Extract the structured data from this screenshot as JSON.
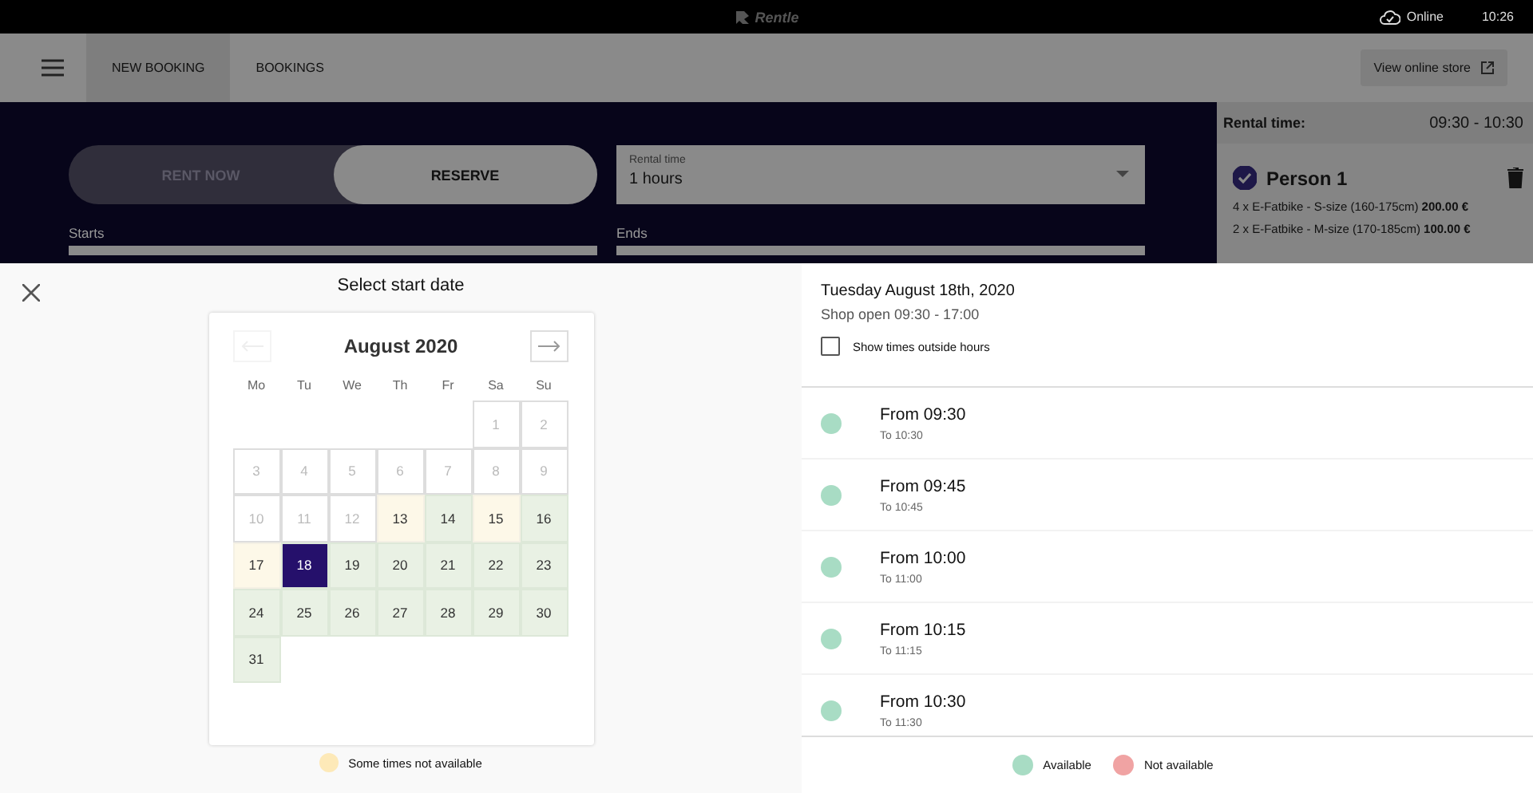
{
  "top_bar": {
    "logo": "Rentle",
    "connection": "Online",
    "time": "10:26"
  },
  "nav": {
    "tabs": [
      {
        "label": "NEW BOOKING",
        "selected": true
      },
      {
        "label": "BOOKINGS",
        "selected": false
      }
    ],
    "store_button": "View online store"
  },
  "booking_form": {
    "modes": [
      {
        "label": "RENT NOW",
        "selected": false
      },
      {
        "label": "RESERVE",
        "selected": true
      }
    ],
    "rental_time": {
      "label": "Rental time",
      "value": "1 hours"
    },
    "starts_label": "Starts",
    "ends_label": "Ends"
  },
  "summary": {
    "rental_time_label": "Rental time:",
    "rental_time_value": "09:30 - 10:30",
    "person": {
      "name": "Person 1",
      "checked": true,
      "items": [
        {
          "text": "4 x E-Fatbike - S-size (160-175cm)",
          "price": "200.00 €"
        },
        {
          "text": "2 x E-Fatbike - M-size (170-185cm)",
          "price": "100.00 €"
        }
      ]
    }
  },
  "date_picker": {
    "title": "Select start date",
    "month": "August 2020",
    "weekdays": [
      "Mo",
      "Tu",
      "We",
      "Th",
      "Fr",
      "Sa",
      "Su"
    ],
    "weeks": [
      [
        {
          "day": "1",
          "kind": "past",
          "selected": false
        },
        {
          "day": "2",
          "kind": "past",
          "selected": false
        }
      ],
      [
        {
          "day": "3",
          "kind": "past",
          "selected": false
        },
        {
          "day": "4",
          "kind": "past",
          "selected": false
        },
        {
          "day": "5",
          "kind": "past",
          "selected": false
        },
        {
          "day": "6",
          "kind": "past",
          "selected": false
        },
        {
          "day": "7",
          "kind": "past",
          "selected": false
        },
        {
          "day": "8",
          "kind": "past",
          "selected": false
        },
        {
          "day": "9",
          "kind": "past",
          "selected": false
        }
      ],
      [
        {
          "day": "10",
          "kind": "past",
          "selected": false
        },
        {
          "day": "11",
          "kind": "past",
          "selected": false
        },
        {
          "day": "12",
          "kind": "past",
          "selected": false
        },
        {
          "day": "13",
          "kind": "partial",
          "selected": false
        },
        {
          "day": "14",
          "kind": "available",
          "selected": false
        },
        {
          "day": "15",
          "kind": "partial",
          "selected": false
        },
        {
          "day": "16",
          "kind": "available",
          "selected": false
        }
      ],
      [
        {
          "day": "17",
          "kind": "partial",
          "selected": false
        },
        {
          "day": "18",
          "kind": "available",
          "selected": true
        },
        {
          "day": "19",
          "kind": "available",
          "selected": false
        },
        {
          "day": "20",
          "kind": "available",
          "selected": false
        },
        {
          "day": "21",
          "kind": "available",
          "selected": false
        },
        {
          "day": "22",
          "kind": "available",
          "selected": false
        },
        {
          "day": "23",
          "kind": "available",
          "selected": false
        }
      ],
      [
        {
          "day": "24",
          "kind": "available",
          "selected": false
        },
        {
          "day": "25",
          "kind": "available",
          "selected": false
        },
        {
          "day": "26",
          "kind": "available",
          "selected": false
        },
        {
          "day": "27",
          "kind": "available",
          "selected": false
        },
        {
          "day": "28",
          "kind": "available",
          "selected": false
        },
        {
          "day": "29",
          "kind": "available",
          "selected": false
        },
        {
          "day": "30",
          "kind": "available",
          "selected": false
        }
      ],
      [
        {
          "day": "31",
          "kind": "available",
          "selected": false
        }
      ]
    ],
    "legend": {
      "label": "Some times not available",
      "color": "#fde9b8"
    }
  },
  "time_picker": {
    "date": "Tuesday August 18th, 2020",
    "hours": "Shop open 09:30 - 17:00",
    "outside_hours": {
      "label": "Show times outside hours",
      "checked": false
    },
    "slots": [
      {
        "from": "From 09:30",
        "to": "To 10:30",
        "color": "#a8dcc4"
      },
      {
        "from": "From 09:45",
        "to": "To 10:45",
        "color": "#a8dcc4"
      },
      {
        "from": "From 10:00",
        "to": "To 11:00",
        "color": "#a8dcc4"
      },
      {
        "from": "From 10:15",
        "to": "To 11:15",
        "color": "#a8dcc4"
      },
      {
        "from": "From 10:30",
        "to": "To 11:30",
        "color": "#a8dcc4"
      }
    ],
    "legend": [
      {
        "label": "Available",
        "color": "#a8dcc4"
      },
      {
        "label": "Not available",
        "color": "#f0a3a3"
      }
    ]
  }
}
